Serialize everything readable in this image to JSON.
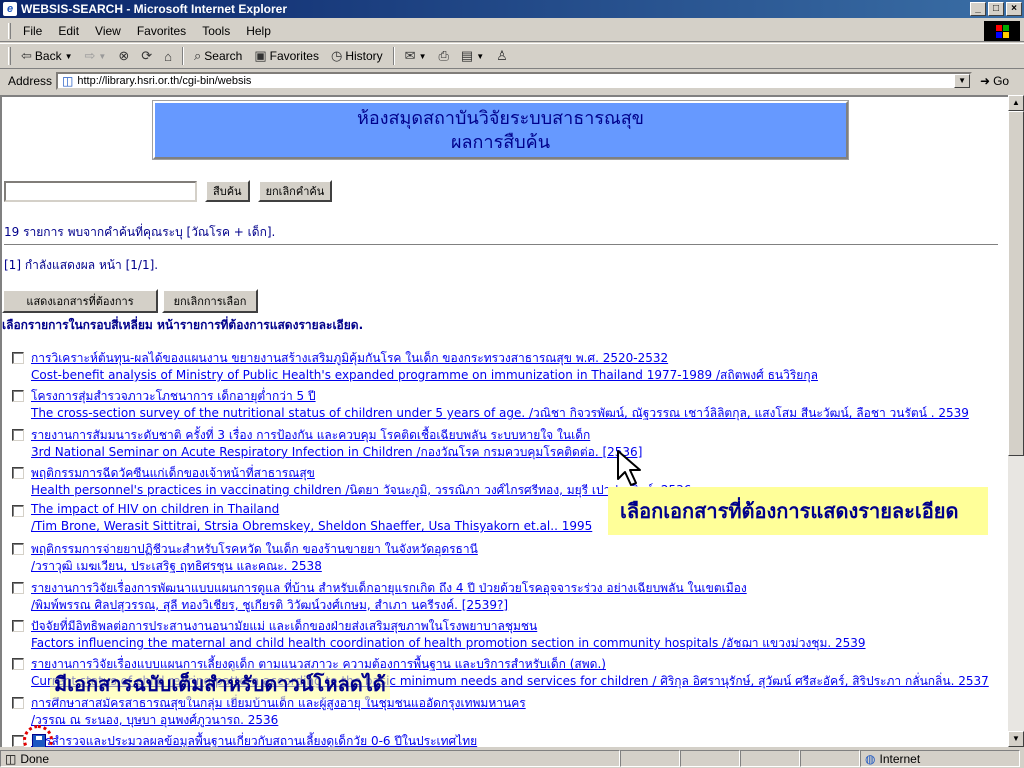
{
  "window": {
    "title": "WEBSIS-SEARCH - Microsoft Internet Explorer",
    "controls": [
      "_",
      "□",
      "×"
    ]
  },
  "menu": [
    "File",
    "Edit",
    "View",
    "Favorites",
    "Tools",
    "Help"
  ],
  "toolbar": {
    "back": "Back",
    "search": "Search",
    "favorites": "Favorites",
    "history": "History"
  },
  "address": {
    "label": "Address",
    "url": "http://library.hsri.or.th/cgi-bin/websis",
    "go": "Go"
  },
  "banner": {
    "line1": "ห้องสมุดสถาบันวิจัยระบบสาธารณสุข",
    "line2": "ผลการสืบค้น"
  },
  "search": {
    "value": "",
    "search_button": "สืบค้น",
    "clear_button": "ยกเลิกคำค้น"
  },
  "result_info": "19 รายการ พบจากคำค้นที่คุณระบุ [วัณโรค + เด็ก].",
  "page_info": "[1] กำลังแสดงผล หน้า [1/1].",
  "actions": {
    "show_button": "แสดงเอกสารที่ต้องการ",
    "cancel_button": "ยกเลิกการเลือก"
  },
  "instruction": "เลือกรายการในกรอบสี่เหลี่ยม หน้ารายการที่ต้องการแสดงรายละเอียด.",
  "results": [
    {
      "line1": "การวิเคราะห์ต้นทุน-ผลได้ของแผนงาน ขยายงานสร้างเสริมภูมิคุ้มกันโรค ในเด็ก ของกระทรวงสาธารณสุข พ.ศ. 2520-2532",
      "line2": "Cost-benefit analysis of Ministry of Public Health's expanded programme on immunization in Thailand 1977-1989 /สถิตพงศ์ ธนวิริยกุล"
    },
    {
      "line1": "โครงการสุ่มสำรวจภาวะโภชนาการ เด็กอายุต่ำกว่า 5 ปี",
      "line2": "The cross-section survey of the nutritional status of children under 5 years of age. /วณิชา กิจวรพัฒน์, ณัฐวรรณ เชาว์ลิลิตกุล, แสงโสม สีนะวัฒน์, ลือชา วนรัตน์ . 2539"
    },
    {
      "line1": "รายงานการสัมมนาระดับชาติ ครั้งที่ 3 เรื่อง การป้องกัน และควบคุม โรคติดเชื้อเฉียบพลัน ระบบหายใจ ในเด็ก",
      "line2": "3rd National Seminar on Acute Respiratory Infection in Children /กองวัณโรค กรมควบคุมโรคติดต่อ. [2536]"
    },
    {
      "line1": "พฤติกรรมการฉีดวัคซีนแก่เด็กของเจ้าหน้าที่สาธารณสุข",
      "line2": "Health personnel's practices in vaccinating children /นิตยา วัจนะภูมิ, วรรณิภา วงศ์ไกรศรีทอง, มยุรี เปาประดิษฐ์. 2536"
    },
    {
      "line1": "The impact of HIV on children in Thailand",
      "line2": "/Tim Brone, Werasit Sittitrai, Strsia Obremskey, Sheldon Shaeffer, Usa Thisyakorn et.al.. 1995"
    },
    {
      "line1": "พฤติกรรมการจ่ายยาปฏิชีวนะสำหรับโรคหวัด ในเด็ก ของร้านขายยา ในจังหวัดอุดรธานี",
      "line2": "/วราวุฒิ เมฆเวียน, ประเสริฐ ฤทธิศรชุน และคณะ. 2538"
    },
    {
      "line1": "รายงานการวิจัยเรื่องการพัฒนาแบบแผนการดูแล ที่บ้าน สำหรับเด็กอายุแรกเกิด ถึง 4 ปี ป่วยด้วยโรคอุจจาระร่วง อย่างเฉียบพลัน ในเขตเมือง",
      "line2": "/พิมพ์พรรณ ศิลปสุวรรณ, สุลี ทองวิเชียร, ชูเกียรติ วิวัฒน์วงศ์เกษม, สำเภา นครีรงค์. [2539?]"
    },
    {
      "line1": "ปัจจัยที่มีอิทธิพลต่อการประสานงานอนามัยแม่ และเด็กของฝ่ายส่งเสริมสุขภาพในโรงพยาบาลชุมชน",
      "line2": "Factors influencing the maternal and child health coordination of health promotion section in community hospitals /อัชฌา แขวงม่วงชุม. 2539"
    },
    {
      "line1": "รายงานการวิจัยเรื่องแบบแผนการเลี้ยงดูเด็ก ตามแนวสภาวะ ความต้องการพื้นฐาน และบริการสำหรับเด็ก (สพด.)",
      "line2": "Current status of child rearing pattern according to the basic minimum needs and services for children / ศิริกุล อิศรานุรักษ์, สุวัฒน์ ศรีสะอัคร์, สิริประภา กลั่นกลิ่น. 2537"
    },
    {
      "line1": "การศึกษาสาสมัครสาธารณสุขในกลุ่ม เยี่ยมบ้านเด็ก และผู้สูงอายุ ในชุมชนแออัดกรุงเทพมหานคร",
      "line2": "/วรรณ ณ ระนอง, บุษบา อุนพงศ์ภูวนารถ. 2536"
    },
    {
      "line1": "การสำรวจและประมวลผลข้อมูลพื้นฐานเกี่ยวกับสถานเลี้ยงดูเด็กวัย 0-6 ปีในประเทศไทย",
      "line2": ""
    }
  ],
  "callouts": {
    "select": "เลือกเอกสารที่ต้องการแสดงรายละเอียด",
    "fulltext": "มีเอกสารฉบับเต็มสำหรับดาวน์โหลดได้"
  },
  "status": {
    "left": "Done",
    "zone": "Internet"
  },
  "colors": {
    "title_bar": "#0a246a",
    "banner_bg": "#6699ff",
    "link": "#0000ee",
    "callout_bg": "#ffff99",
    "text_blue": "#00008b",
    "highlight_circle": "#e00000"
  }
}
